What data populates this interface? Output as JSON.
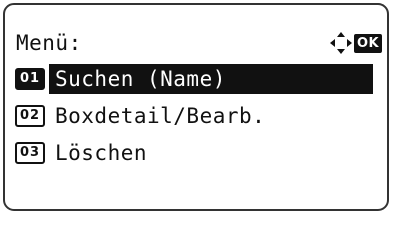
{
  "screen": {
    "title": "Menü:",
    "ok_label": "OK",
    "nav_icon": "four-way-arrows-icon"
  },
  "menu": {
    "items": [
      {
        "number": "01",
        "label": "Suchen (Name)",
        "selected": true
      },
      {
        "number": "02",
        "label": "Boxdetail/Bearb.",
        "selected": false
      },
      {
        "number": "03",
        "label": "Löschen",
        "selected": false
      }
    ]
  },
  "colors": {
    "foreground": "#111111",
    "background": "#ffffff",
    "border": "#333333"
  }
}
